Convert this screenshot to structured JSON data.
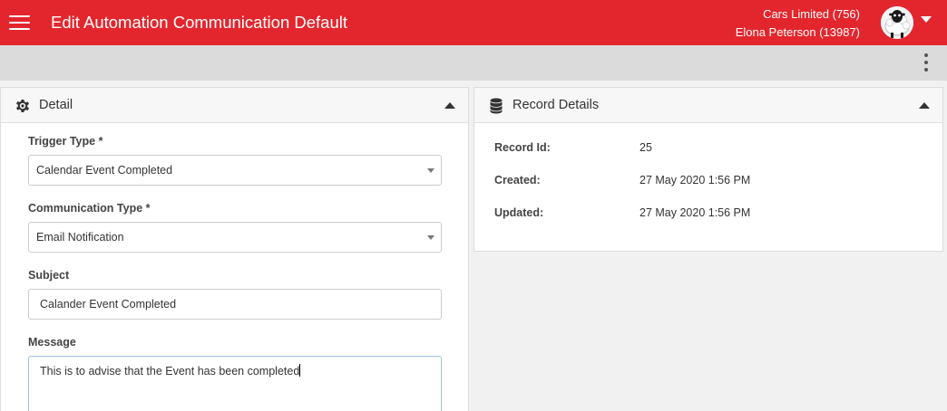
{
  "header": {
    "title": "Edit Automation Communication Default",
    "company": "Cars Limited (756)",
    "user": "Elona Peterson (13987)",
    "color": "#e3262d"
  },
  "detail_panel": {
    "title": "Detail",
    "icon": "gear-icon",
    "fields": {
      "trigger_type": {
        "label": "Trigger Type *",
        "value": "Calendar Event Completed"
      },
      "communication_type": {
        "label": "Communication Type *",
        "value": "Email Notification"
      },
      "subject": {
        "label": "Subject",
        "value": "Calander Event Completed"
      },
      "message": {
        "label": "Message",
        "value": "This is to advise that the Event has been completed"
      }
    }
  },
  "record_panel": {
    "title": "Record Details",
    "icon": "database-icon",
    "rows": [
      {
        "label": "Record Id:",
        "value": "25"
      },
      {
        "label": "Created:",
        "value": "27 May 2020 1:56 PM"
      },
      {
        "label": "Updated:",
        "value": "27 May 2020 1:56 PM"
      }
    ]
  }
}
